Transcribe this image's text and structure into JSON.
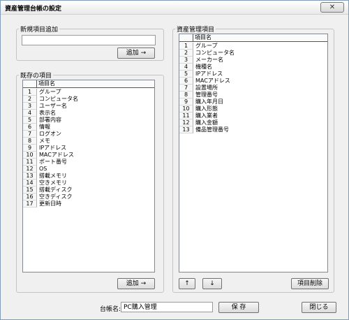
{
  "window": {
    "title": "資産管理台帳の設定",
    "close_label": "✕"
  },
  "new_item": {
    "legend": "新規項目追加",
    "input_value": "",
    "add_label": "追加 →"
  },
  "existing": {
    "legend": "既存の項目",
    "header": "項目名",
    "add_label": "追加 →",
    "items": [
      {
        "num": "1",
        "name": "グループ"
      },
      {
        "num": "2",
        "name": "コンピュータ名"
      },
      {
        "num": "3",
        "name": "ユーザー名"
      },
      {
        "num": "4",
        "name": "表示名"
      },
      {
        "num": "5",
        "name": "部署内容"
      },
      {
        "num": "6",
        "name": "情報"
      },
      {
        "num": "7",
        "name": "ログオン"
      },
      {
        "num": "8",
        "name": "メモ"
      },
      {
        "num": "9",
        "name": "IPアドレス"
      },
      {
        "num": "10",
        "name": "MACアドレス"
      },
      {
        "num": "11",
        "name": "ポート番号"
      },
      {
        "num": "12",
        "name": "OS"
      },
      {
        "num": "13",
        "name": "搭載メモリ"
      },
      {
        "num": "14",
        "name": "空きメモリ"
      },
      {
        "num": "15",
        "name": "搭載ディスク"
      },
      {
        "num": "16",
        "name": "空きディスク"
      },
      {
        "num": "17",
        "name": "更新日時"
      }
    ]
  },
  "asset": {
    "legend": "資産管理項目",
    "header": "項目名",
    "up_label": "↑",
    "down_label": "↓",
    "delete_label": "項目削除",
    "items": [
      {
        "num": "1",
        "name": "グループ"
      },
      {
        "num": "2",
        "name": "コンピュータ名"
      },
      {
        "num": "3",
        "name": "メーカー名"
      },
      {
        "num": "4",
        "name": "機種名"
      },
      {
        "num": "5",
        "name": "IPアドレス"
      },
      {
        "num": "6",
        "name": "MACアドレス"
      },
      {
        "num": "7",
        "name": "設置場所"
      },
      {
        "num": "8",
        "name": "管理番号"
      },
      {
        "num": "9",
        "name": "購入年月日"
      },
      {
        "num": "10",
        "name": "購入形態"
      },
      {
        "num": "11",
        "name": "購入業者"
      },
      {
        "num": "12",
        "name": "購入金額"
      },
      {
        "num": "13",
        "name": "備品管理番号"
      }
    ]
  },
  "footer": {
    "ledger_label": "台帳名:",
    "ledger_value": "PC購入管理",
    "save_label": "保 存",
    "close_label": "閉じる"
  }
}
